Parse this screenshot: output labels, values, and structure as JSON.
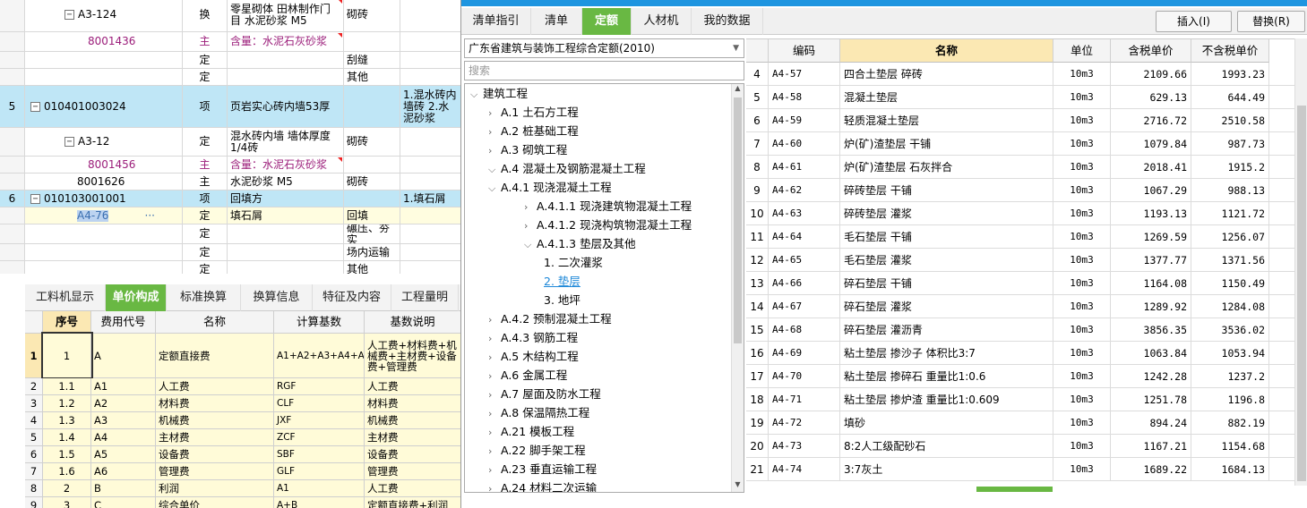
{
  "left_rows": [
    {
      "num": "",
      "code": "A3-124",
      "type": "换",
      "name": "零星砌体 田林制作门目 水泥砂浆 M5",
      "unit": "砌砖",
      "desc": "",
      "style": "sub",
      "expand": "−"
    },
    {
      "num": "",
      "code": "8001436",
      "type": "主",
      "name": "含量：水泥石灰砂浆",
      "unit": "",
      "desc": "",
      "style": "purple"
    },
    {
      "num": "",
      "code": "",
      "type": "定",
      "name": "",
      "unit": "刮缝",
      "desc": "",
      "style": ""
    },
    {
      "num": "",
      "code": "",
      "type": "定",
      "name": "",
      "unit": "其他",
      "desc": "",
      "style": ""
    },
    {
      "num": "5",
      "code": "010401003024",
      "type": "项",
      "name": "页岩实心砖内墙53厚",
      "unit": "",
      "desc": "1.混水砖内墙砖 2.水泥砂浆",
      "style": "hl",
      "expand": "−"
    },
    {
      "num": "",
      "code": "A3-12",
      "type": "定",
      "name": "混水砖内墙 墙体厚度1/4砖",
      "unit": "砌砖",
      "desc": "",
      "style": "sub",
      "expand": "−"
    },
    {
      "num": "",
      "code": "8001456",
      "type": "主",
      "name": "含量：水泥石灰砂浆",
      "unit": "",
      "desc": "",
      "style": "purple"
    },
    {
      "num": "",
      "code": "8001626",
      "type": "主",
      "name": "水泥砂浆 M5",
      "unit": "砌砖",
      "desc": "",
      "style": ""
    },
    {
      "num": "6",
      "code": "010103001001",
      "type": "项",
      "name": "回填方",
      "unit": "",
      "desc": "1.填石屑",
      "style": "hl",
      "expand": "−"
    },
    {
      "num": "",
      "code": "A4-76",
      "type": "定",
      "name": "填石屑",
      "unit": "回填",
      "desc": "",
      "style": "sel"
    },
    {
      "num": "",
      "code": "",
      "type": "定",
      "name": "",
      "unit": "碾压、夯实",
      "desc": "",
      "style": ""
    },
    {
      "num": "",
      "code": "",
      "type": "定",
      "name": "",
      "unit": "场内运输",
      "desc": "",
      "style": ""
    },
    {
      "num": "",
      "code": "",
      "type": "定",
      "name": "",
      "unit": "其他",
      "desc": "",
      "style": ""
    }
  ],
  "bottom_tabs": [
    "工料机显示",
    "单价构成",
    "标准换算",
    "换算信息",
    "特征及内容",
    "工程量明"
  ],
  "bottom_active_tab": 1,
  "lower_headers": [
    "序号",
    "费用代号",
    "名称",
    "计算基数",
    "基数说明"
  ],
  "lower_rows": [
    {
      "rn": "1",
      "seq": "1",
      "code": "A",
      "name": "定额直接费",
      "base": "A1+A2+A3+A4+A5+A6",
      "desc": "人工费+材料费+机械费+主材费+设备费+管理费"
    },
    {
      "rn": "2",
      "seq": "1.1",
      "code": "A1",
      "name": "人工费",
      "base": "RGF",
      "desc": "人工费"
    },
    {
      "rn": "3",
      "seq": "1.2",
      "code": "A2",
      "name": "材料费",
      "base": "CLF",
      "desc": "材料费"
    },
    {
      "rn": "4",
      "seq": "1.3",
      "code": "A3",
      "name": "机械费",
      "base": "JXF",
      "desc": "机械费"
    },
    {
      "rn": "5",
      "seq": "1.4",
      "code": "A4",
      "name": "主材费",
      "base": "ZCF",
      "desc": "主材费"
    },
    {
      "rn": "6",
      "seq": "1.5",
      "code": "A5",
      "name": "设备费",
      "base": "SBF",
      "desc": "设备费"
    },
    {
      "rn": "7",
      "seq": "1.6",
      "code": "A6",
      "name": "管理费",
      "base": "GLF",
      "desc": "管理费"
    },
    {
      "rn": "8",
      "seq": "2",
      "code": "B",
      "name": "利润",
      "base": "A1",
      "desc": "人工费"
    },
    {
      "rn": "9",
      "seq": "3",
      "code": "C",
      "name": "综合单价",
      "base": "A+B",
      "desc": "定额直接费+利润"
    }
  ],
  "dialog": {
    "tabs": [
      "清单指引",
      "清单",
      "定额",
      "人材机",
      "我的数据"
    ],
    "active_tab": 2,
    "insert_label": "插入(I)",
    "replace_label": "替换(R)",
    "library": "广东省建筑与装饰工程综合定额(2010)",
    "search_placeholder": "搜索",
    "tree": [
      {
        "label": "建筑工程",
        "level": 0,
        "arrow": "⌄"
      },
      {
        "label": "A.1 土石方工程",
        "level": 1,
        "arrow": "›"
      },
      {
        "label": "A.2 桩基础工程",
        "level": 1,
        "arrow": "›"
      },
      {
        "label": "A.3 砌筑工程",
        "level": 1,
        "arrow": "›"
      },
      {
        "label": "A.4 混凝土及钢筋混凝土工程",
        "level": 1,
        "arrow": "⌄"
      },
      {
        "label": "A.4.1 现浇混凝土工程",
        "level": 2,
        "arrow": "⌄"
      },
      {
        "label": "A.4.1.1 现浇建筑物混凝土工程",
        "level": 3,
        "arrow": "›"
      },
      {
        "label": "A.4.1.2 现浇构筑物混凝土工程",
        "level": 3,
        "arrow": "›"
      },
      {
        "label": "A.4.1.3 垫层及其他",
        "level": 3,
        "arrow": "⌄"
      },
      {
        "label": "1. 二次灌浆",
        "level": 4,
        "arrow": ""
      },
      {
        "label": "2. 垫层",
        "level": 4,
        "arrow": "",
        "selected": true
      },
      {
        "label": "3. 地坪",
        "level": 4,
        "arrow": ""
      },
      {
        "label": "A.4.2 预制混凝土工程",
        "level": 2,
        "arrow": "›"
      },
      {
        "label": "A.4.3 钢筋工程",
        "level": 2,
        "arrow": "›"
      },
      {
        "label": "A.5 木结构工程",
        "level": 1,
        "arrow": "›"
      },
      {
        "label": "A.6 金属工程",
        "level": 1,
        "arrow": "›"
      },
      {
        "label": "A.7 屋面及防水工程",
        "level": 1,
        "arrow": "›"
      },
      {
        "label": "A.8 保温隔热工程",
        "level": 1,
        "arrow": "›"
      },
      {
        "label": "A.21 模板工程",
        "level": 1,
        "arrow": "›"
      },
      {
        "label": "A.22 脚手架工程",
        "level": 1,
        "arrow": "›"
      },
      {
        "label": "A.23 垂直运输工程",
        "level": 1,
        "arrow": "›"
      },
      {
        "label": "A.24 材料二次运输",
        "level": 1,
        "arrow": "›"
      }
    ],
    "table_headers": [
      "",
      "编码",
      "名称",
      "单位",
      "含税单价",
      "不含税单价"
    ],
    "table_rows": [
      {
        "n": "4",
        "code": "A4-57",
        "name": "四合土垫层 碎砖",
        "unit": "10m3",
        "tax": "2109.66",
        "notax": "1993.23"
      },
      {
        "n": "5",
        "code": "A4-58",
        "name": "混凝土垫层",
        "unit": "10m3",
        "tax": "629.13",
        "notax": "644.49"
      },
      {
        "n": "6",
        "code": "A4-59",
        "name": "轻质混凝土垫层",
        "unit": "10m3",
        "tax": "2716.72",
        "notax": "2510.58"
      },
      {
        "n": "7",
        "code": "A4-60",
        "name": "炉(矿)渣垫层 干铺",
        "unit": "10m3",
        "tax": "1079.84",
        "notax": "987.73"
      },
      {
        "n": "8",
        "code": "A4-61",
        "name": "炉(矿)渣垫层 石灰拌合",
        "unit": "10m3",
        "tax": "2018.41",
        "notax": "1915.2"
      },
      {
        "n": "9",
        "code": "A4-62",
        "name": "碎砖垫层 干铺",
        "unit": "10m3",
        "tax": "1067.29",
        "notax": "988.13"
      },
      {
        "n": "10",
        "code": "A4-63",
        "name": "碎砖垫层 灌浆",
        "unit": "10m3",
        "tax": "1193.13",
        "notax": "1121.72"
      },
      {
        "n": "11",
        "code": "A4-64",
        "name": "毛石垫层 干铺",
        "unit": "10m3",
        "tax": "1269.59",
        "notax": "1256.07"
      },
      {
        "n": "12",
        "code": "A4-65",
        "name": "毛石垫层 灌浆",
        "unit": "10m3",
        "tax": "1377.77",
        "notax": "1371.56"
      },
      {
        "n": "13",
        "code": "A4-66",
        "name": "碎石垫层 干铺",
        "unit": "10m3",
        "tax": "1164.08",
        "notax": "1150.49"
      },
      {
        "n": "14",
        "code": "A4-67",
        "name": "碎石垫层 灌浆",
        "unit": "10m3",
        "tax": "1289.92",
        "notax": "1284.08"
      },
      {
        "n": "15",
        "code": "A4-68",
        "name": "碎石垫层 灌沥青",
        "unit": "10m3",
        "tax": "3856.35",
        "notax": "3536.02"
      },
      {
        "n": "16",
        "code": "A4-69",
        "name": "粘土垫层 掺沙子 体积比3:7",
        "unit": "10m3",
        "tax": "1063.84",
        "notax": "1053.94"
      },
      {
        "n": "17",
        "code": "A4-70",
        "name": "粘土垫层 掺碎石 重量比1:0.6",
        "unit": "10m3",
        "tax": "1242.28",
        "notax": "1237.2"
      },
      {
        "n": "18",
        "code": "A4-71",
        "name": "粘土垫层 掺炉渣 重量比1:0.609",
        "unit": "10m3",
        "tax": "1251.78",
        "notax": "1196.8"
      },
      {
        "n": "19",
        "code": "A4-72",
        "name": "填砂",
        "unit": "10m3",
        "tax": "894.24",
        "notax": "882.19"
      },
      {
        "n": "20",
        "code": "A4-73",
        "name": "8:2人工级配砂石",
        "unit": "10m3",
        "tax": "1167.21",
        "notax": "1154.68"
      },
      {
        "n": "21",
        "code": "A4-74",
        "name": "3:7灰土",
        "unit": "10m3",
        "tax": "1689.22",
        "notax": "1684.13"
      }
    ]
  },
  "colors": {
    "accent": "#69b843",
    "titlebar": "#1e95e0",
    "highlight": "#bfe6f6",
    "name_header": "#fbe8b3"
  }
}
